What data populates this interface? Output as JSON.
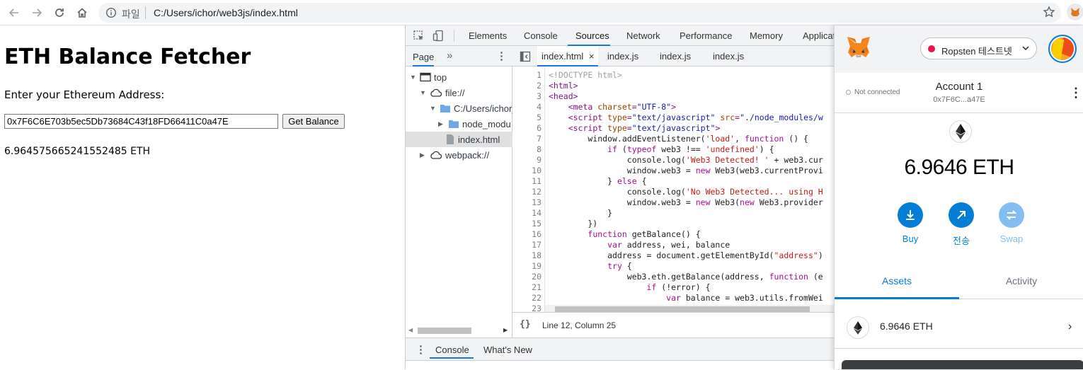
{
  "browser": {
    "scheme_label": "파일",
    "url": "C:/Users/ichor/web3js/index.html"
  },
  "page": {
    "title": "ETH Balance Fetcher",
    "prompt": "Enter your Ethereum Address:",
    "address_value": "0x7F6C6E703b5ec5Db73684C43f18FD66411C0a47E",
    "button_label": "Get Balance",
    "result": "6.964575665241552485 ETH"
  },
  "devtools": {
    "tabs": [
      "Elements",
      "Console",
      "Sources",
      "Network",
      "Performance",
      "Memory",
      "Applicat"
    ],
    "active_tab": "Sources",
    "navigator": {
      "tab_label": "Page",
      "tree": [
        "top",
        "file://",
        "C:/Users/ichor_",
        "node_modu",
        "index.html",
        "webpack://"
      ]
    },
    "editor_tabs": [
      "index.html",
      "index.js",
      "index.js",
      "index.js"
    ],
    "line_numbers": [
      "1",
      "2",
      "3",
      "4",
      "5",
      "6",
      "7",
      "8",
      "9",
      "10",
      "11",
      "12",
      "13",
      "14",
      "15",
      "16",
      "17",
      "18",
      "19",
      "20",
      "21",
      "22",
      "23"
    ],
    "status": "Line 12, Column 25",
    "drawer_tabs": [
      "Console",
      "What's New"
    ]
  },
  "metamask": {
    "network": "Ropsten 테스트넷",
    "connection": "Not connected",
    "account_name": "Account 1",
    "account_address": "0x7F6C...a47E",
    "balance": "6.9646 ETH",
    "actions": [
      "Buy",
      "전송",
      "Swap"
    ],
    "tabs": [
      "Assets",
      "Activity"
    ],
    "asset_amount": "6.9646 ETH",
    "colors": {
      "accent": "#037dd6",
      "network_dot": "#e91550"
    }
  }
}
